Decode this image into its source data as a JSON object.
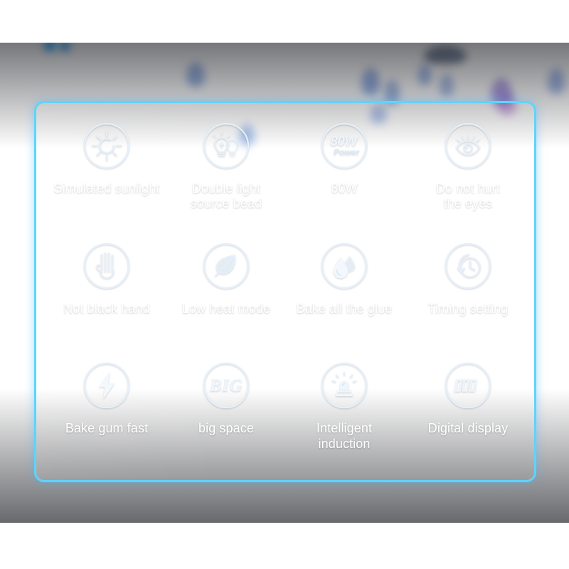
{
  "scene": {
    "background_top_color": "#ffffff",
    "backdrop_color": "#070a12",
    "panel_border_color": "#5ed4fb",
    "panel_gradient_top": "#2a7fdc",
    "panel_gradient_bottom": "#1b3c7f",
    "label_color": "#ffffff",
    "icon_color": "#e9f2fb"
  },
  "panel": {
    "features": [
      {
        "id": "simulated-sunlight",
        "icon": "sun-icon",
        "label": "Simulated sunlight"
      },
      {
        "id": "double-light-source",
        "icon": "double-bulb-icon",
        "label": "Double light\nsource bead"
      },
      {
        "id": "power-80w",
        "icon": "power-80w-icon",
        "label": "80W",
        "icon_text": {
          "value": "80W",
          "unit": "Power"
        }
      },
      {
        "id": "eye-safe",
        "icon": "eye-icon",
        "label": "Do not hurt\nthe eyes"
      },
      {
        "id": "not-black-hand",
        "icon": "hand-icon",
        "label": "Not black hand"
      },
      {
        "id": "low-heat-mode",
        "icon": "leaf-icon",
        "label": "Low heat mode"
      },
      {
        "id": "bake-all-glue",
        "icon": "water-drops-icon",
        "label": "Bake all the glue"
      },
      {
        "id": "timing-setting",
        "icon": "clock-arrow-icon",
        "label": "Timing setting"
      },
      {
        "id": "bake-gum-fast",
        "icon": "lightning-bolt-icon",
        "label": "Bake gum fast"
      },
      {
        "id": "big-space",
        "icon": "big-text-icon",
        "label": "big space",
        "icon_text": {
          "value": "BIG"
        }
      },
      {
        "id": "intelligent-induction",
        "icon": "siren-icon",
        "label": "Intelligent\ninduction"
      },
      {
        "id": "digital-display",
        "icon": "digital-000-icon",
        "label": "Digital display",
        "icon_text": {
          "value": "000"
        }
      }
    ]
  }
}
